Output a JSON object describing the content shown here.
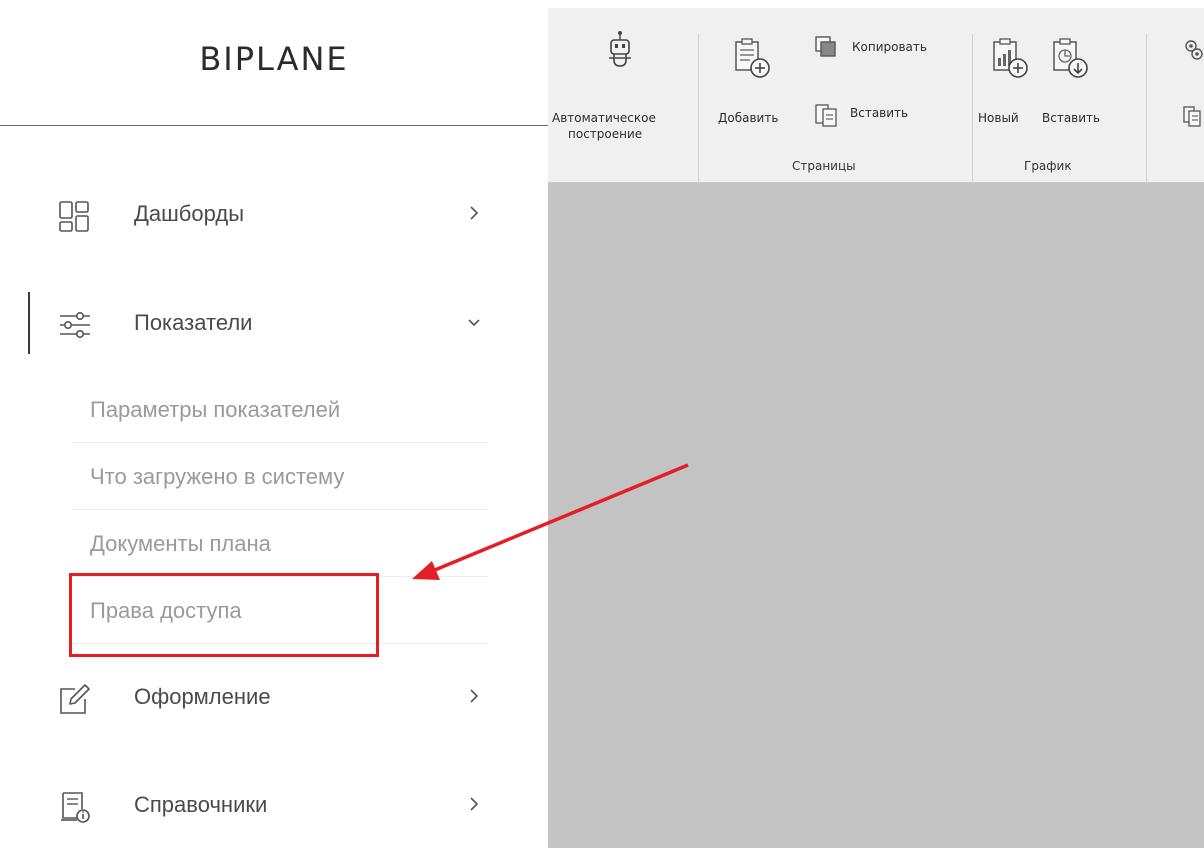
{
  "app": {
    "logo": "BIPLANE"
  },
  "sidebar": {
    "items": [
      {
        "label": "Дашборды",
        "icon": "dashboard-grid-icon",
        "arrow": "chevron-right-icon"
      },
      {
        "label": "Показатели",
        "icon": "sliders-icon",
        "arrow": "chevron-down-icon",
        "active": true
      },
      {
        "label": "Оформление",
        "icon": "edit-icon",
        "arrow": "chevron-right-icon"
      },
      {
        "label": "Справочники",
        "icon": "reference-book-icon",
        "arrow": "chevron-right-icon"
      }
    ],
    "subitems": [
      {
        "label": "Параметры показателей"
      },
      {
        "label": "Что загружено в систему"
      },
      {
        "label": "Документы плана"
      },
      {
        "label": "Права доступа"
      }
    ]
  },
  "ribbon": {
    "auto_build_line1": "Автоматическое",
    "auto_build_line2": "построение",
    "pages": {
      "add": "Добавить",
      "copy": "Копировать",
      "paste": "Вставить",
      "group": "Страницы"
    },
    "chart": {
      "new": "Новый",
      "paste": "Вставить",
      "group": "График"
    }
  },
  "annotation": {
    "arrow_color": "#e31e24",
    "box_color": "#e31e24"
  },
  "colors": {
    "workspace": "#c3c3c3",
    "ribbon": "#f0f0f0",
    "sub_text": "#9a9a9a"
  }
}
